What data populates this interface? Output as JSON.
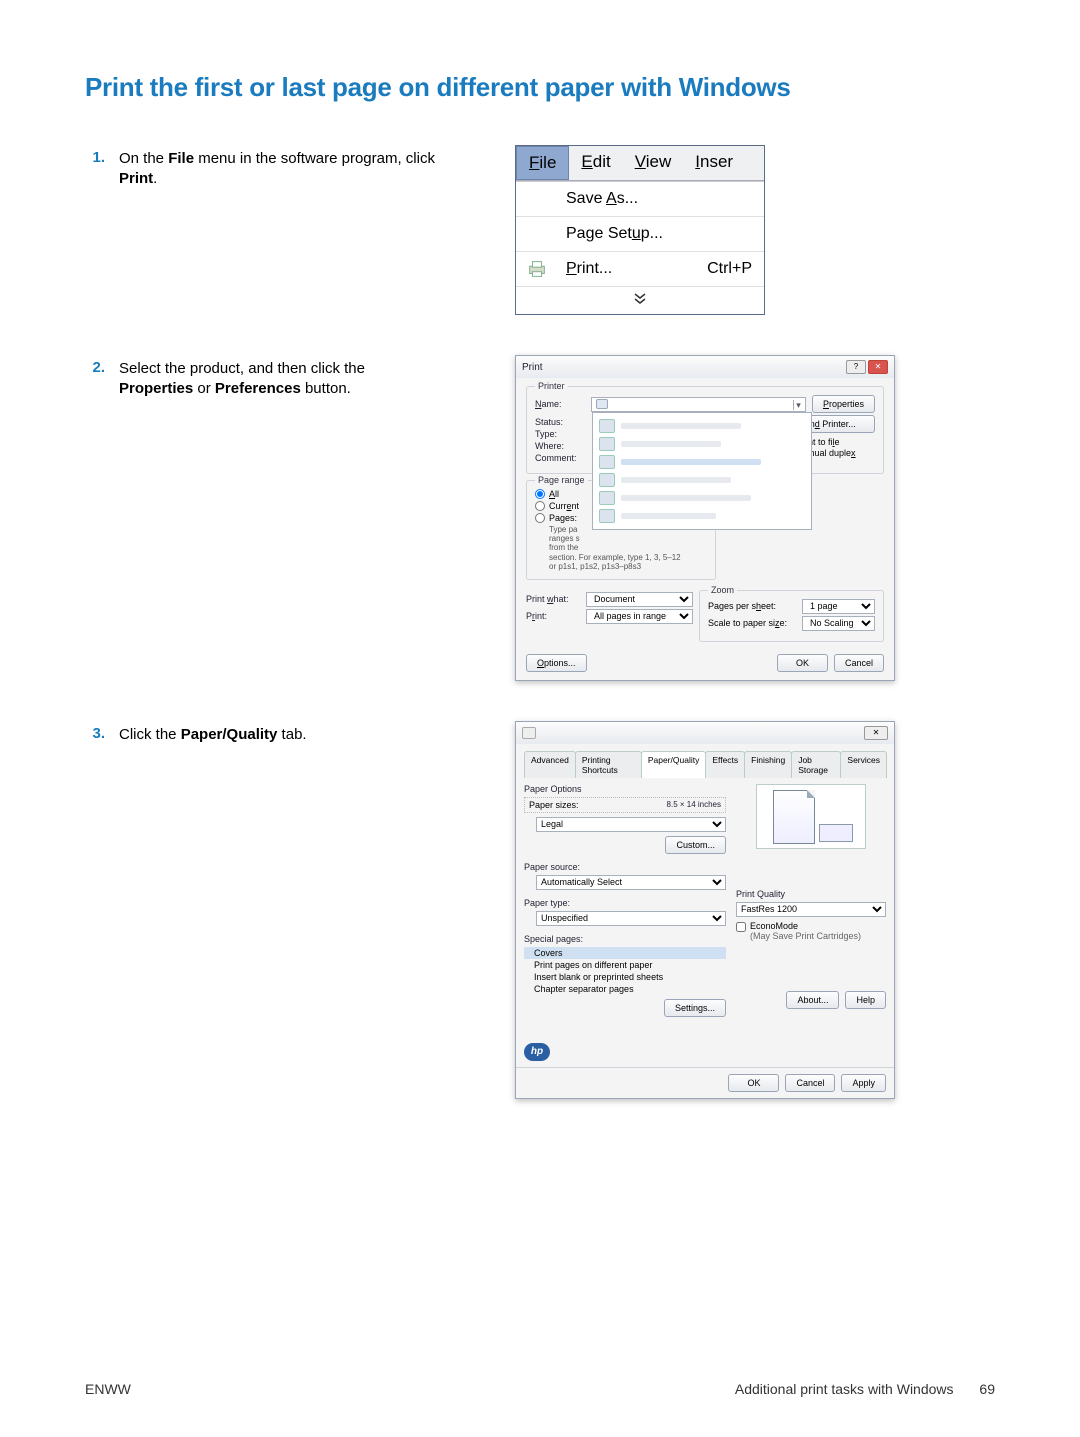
{
  "heading": "Print the first or last page on different paper with Windows",
  "steps": [
    {
      "num": "1.",
      "html": "On the <b>File</b> menu in the software program, click <b>Print</b>."
    },
    {
      "num": "2.",
      "html": "Select the product, and then click the <b>Properties</b> or <b>Preferences</b> button."
    },
    {
      "num": "3.",
      "html": "Click the <b>Paper/Quality</b> tab."
    }
  ],
  "fig1": {
    "menubar": {
      "file": "File",
      "edit": "Edit",
      "view": "View",
      "inser": "Inser"
    },
    "items": {
      "saveas": "Save As...",
      "pagesetup": "Page Setup...",
      "print": "Print...",
      "print_shortcut": "Ctrl+P"
    },
    "scroll": "⮟"
  },
  "fig2": {
    "title": "Print",
    "printer_group": "Printer",
    "name": "Name:",
    "status": "Status:",
    "type": "Type:",
    "where": "Where:",
    "comment": "Comment:",
    "properties": "Properties",
    "find_printer": "Find Printer...",
    "print_to_file": "Print to file",
    "manual_duplex": "Manual duplex",
    "page_range": "Page range",
    "all": "All",
    "current": "Current",
    "pages": "Pages:",
    "pages_hint": "Type pa\nranges s\nfrom the\nsection. For example, type 1, 3, 5–12 or p1s1, p1s2, p1s3–p8s3",
    "print_what": "Print what:",
    "print_what_val": "Document",
    "print_lbl": "Print:",
    "print_val": "All pages in range",
    "zoom": "Zoom",
    "pps": "Pages per sheet:",
    "pps_val": "1 page",
    "scale": "Scale to paper size:",
    "scale_val": "No Scaling",
    "options": "Options...",
    "ok": "OK",
    "cancel": "Cancel"
  },
  "fig3": {
    "tabs": [
      "Advanced",
      "Printing Shortcuts",
      "Paper/Quality",
      "Effects",
      "Finishing",
      "Job Storage",
      "Services"
    ],
    "active_tab": 2,
    "paper_options": "Paper Options",
    "paper_sizes": "Paper sizes:",
    "size_val": "8.5 × 14 inches",
    "size_sel": "Legal",
    "custom": "Custom...",
    "paper_source": "Paper source:",
    "source_val": "Automatically Select",
    "paper_type": "Paper type:",
    "type_val": "Unspecified",
    "special_pages": "Special pages:",
    "sp_items": [
      "Covers",
      "Print pages on different paper",
      "Insert blank or preprinted sheets",
      "Chapter separator pages"
    ],
    "settings": "Settings...",
    "print_quality": "Print Quality",
    "pq_val": "FastRes 1200",
    "econo": "EconoMode",
    "econo_sub": "(May Save Print Cartridges)",
    "about": "About...",
    "help": "Help",
    "ok": "OK",
    "cancel": "Cancel",
    "apply": "Apply",
    "hp": "hp"
  },
  "footer": {
    "left": "ENWW",
    "right": "Additional print tasks with Windows",
    "pagenum": "69"
  }
}
